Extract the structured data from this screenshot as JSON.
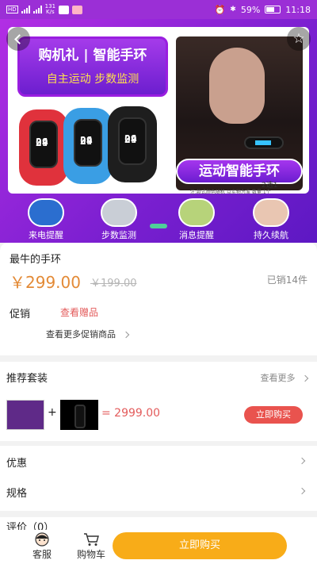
{
  "statusbar": {
    "net_speed_value": "131",
    "net_speed_unit": "K/s",
    "battery": "59%",
    "time": "11:18",
    "icons": [
      "hd-icon",
      "signal-icon",
      "wechat-icon",
      "app-icon",
      "alarm-icon",
      "vibrate-icon",
      "battery-icon"
    ]
  },
  "hero": {
    "promo_title": "购机礼 | 智能手环",
    "promo_subtitle": "自主运动 步数监测",
    "badge": "运动智能手环",
    "select_note": "2选1",
    "disclaimer": "注:款式颜色随机 以实物为准 数量:1个",
    "band_time_h": "09",
    "band_time_m": "24",
    "features": [
      "来电提醒",
      "步数监测",
      "消息提醒",
      "持久续航"
    ],
    "colors": {
      "accent": "#9b2fd6",
      "band_red": "#e0323c",
      "band_blue": "#3a9ee4",
      "band_black": "#1e1e1e"
    }
  },
  "product": {
    "name": "最牛的手环",
    "price": "￥299.00",
    "original_price": "￥199.00",
    "sold": "已销14件",
    "promo_label": "促销",
    "promo_link": "查看赠品",
    "more_promo": "查看更多促销商品"
  },
  "bundle": {
    "title": "推荐套装",
    "more": "查看更多",
    "plus": "+",
    "price": "= 2999.00",
    "buy": "立即购买"
  },
  "rows": {
    "discount": "优惠",
    "spec": "规格"
  },
  "review": {
    "title": "评价（0）"
  },
  "bottombar": {
    "service": "客服",
    "cart": "购物车",
    "buy_now": "立即购买",
    "colors": {
      "buy": "#f8ac18"
    }
  }
}
